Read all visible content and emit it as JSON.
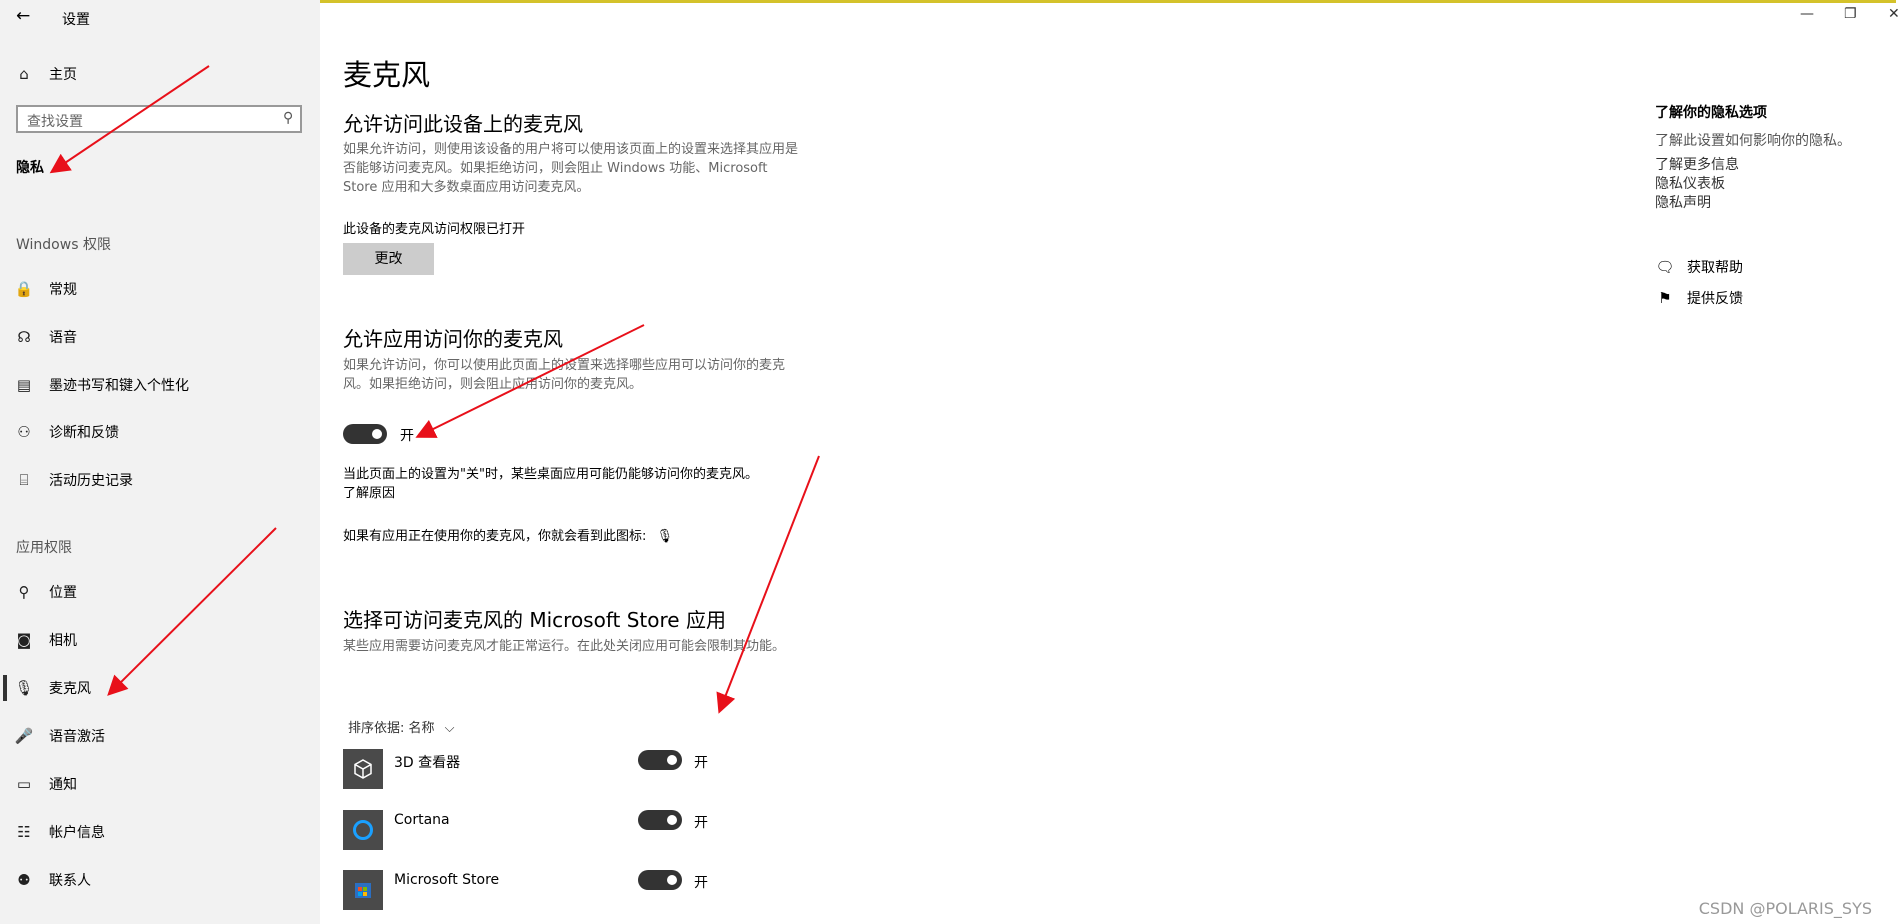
{
  "window": {
    "back_icon": "←",
    "title": "设置",
    "minimize_icon": "—",
    "maximize_icon": "❐",
    "close_icon": "✕"
  },
  "sidebar": {
    "home": {
      "icon": "⌂",
      "label": "主页"
    },
    "search": {
      "placeholder": "查找设置",
      "icon": "⚲"
    },
    "current": "隐私",
    "section_windows": "Windows 权限",
    "windows_items": [
      {
        "icon": "🔒",
        "label": "常规"
      },
      {
        "icon": "☊",
        "label": "语音"
      },
      {
        "icon": "▤",
        "label": "墨迹书写和键入个性化"
      },
      {
        "icon": "⚇",
        "label": "诊断和反馈"
      },
      {
        "icon": "⌸",
        "label": "活动历史记录"
      }
    ],
    "section_apps": "应用权限",
    "app_items": [
      {
        "icon": "⚲",
        "label": "位置"
      },
      {
        "icon": "◙",
        "label": "相机"
      },
      {
        "icon": "🎙",
        "label": "麦克风"
      },
      {
        "icon": "🎤",
        "label": "语音激活"
      },
      {
        "icon": "▭",
        "label": "通知"
      },
      {
        "icon": "☷",
        "label": "帐户信息"
      },
      {
        "icon": "⚉",
        "label": "联系人"
      }
    ]
  },
  "main": {
    "title": "麦克风",
    "section1": {
      "heading": "允许访问此设备上的麦克风",
      "desc": "如果允许访问，则使用该设备的用户将可以使用该页面上的设置来选择其应用是否能够访问麦克风。如果拒绝访问，则会阻止 Windows 功能、Microsoft Store 应用和大多数桌面应用访问麦克风。",
      "status": "此设备的麦克风访问权限已打开",
      "button": "更改"
    },
    "section2": {
      "heading": "允许应用访问你的麦克风",
      "desc": "如果允许访问，你可以使用此页面上的设置来选择哪些应用可以访问你的麦克风。如果拒绝访问，则会阻止应用访问你的麦克风。",
      "toggle_state": "开",
      "note": "当此页面上的设置为\"关\"时，某些桌面应用可能仍能够访问你的麦克风。",
      "note_link": "了解原因",
      "icon_note": "如果有应用正在使用你的麦克风，你就会看到此图标:",
      "mic_icon": "🎙"
    },
    "section3": {
      "heading": "选择可访问麦克风的 Microsoft Store 应用",
      "desc": "某些应用需要访问麦克风才能正常运行。在此处关闭应用可能会限制其功能。",
      "sort_label": "排序依据: 名称",
      "sort_icon": "⌵",
      "apps": [
        {
          "name": "3D 查看器",
          "state": "开",
          "icon": "cube-icon"
        },
        {
          "name": "Cortana",
          "state": "开",
          "icon": "cortana-ring-icon"
        },
        {
          "name": "Microsoft Store",
          "state": "开",
          "icon": "store-bag-icon"
        }
      ]
    }
  },
  "right": {
    "title": "了解你的隐私选项",
    "text": "了解此设置如何影响你的隐私。",
    "links": [
      "了解更多信息",
      "隐私仪表板",
      "隐私声明"
    ],
    "help": {
      "icon": "🗨",
      "label": "获取帮助"
    },
    "feedback": {
      "icon": "⚑",
      "label": "提供反馈"
    }
  },
  "watermark": "CSDN @POLARIS_SYS",
  "colors": {
    "accent": "#333333",
    "annotation_arrow": "#e8101a",
    "frame": "#d4c22a"
  }
}
